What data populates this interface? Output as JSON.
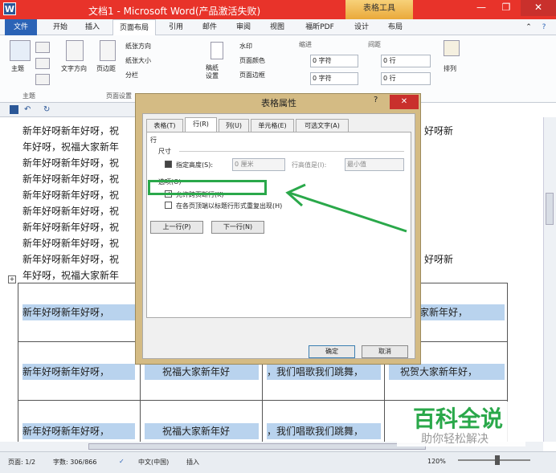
{
  "window": {
    "title": "文档1 - Microsoft Word(产品激活失败)",
    "context_tab": "表格工具",
    "app_icon": "W"
  },
  "tabs": [
    "文件",
    "开始",
    "插入",
    "页面布局",
    "引用",
    "邮件",
    "审阅",
    "视图",
    "福昕PDF",
    "设计",
    "布局"
  ],
  "ribbon": {
    "theme": {
      "label": "主题",
      "group": "主题"
    },
    "page_setup": {
      "direction": "文字方向",
      "margins": "页边距",
      "orientation": "纸张方向",
      "size": "纸张大小",
      "columns": "分栏",
      "group": "页面设置"
    },
    "draft": "稿纸\n设置",
    "bg": {
      "watermark": "水印",
      "page_color": "页面颜色",
      "page_border": "页面边框"
    },
    "indent": {
      "label": "缩进",
      "left": "0 字符",
      "right": "0 字符"
    },
    "spacing": {
      "label": "间距",
      "before": "0 行",
      "after": "0 行"
    },
    "arrange": "排列"
  },
  "document": {
    "lines": [
      "新年好呀新年好呀，祝",
      "年好呀，祝福大家新年",
      "新年好呀新年好呀，祝",
      "新年好呀新年好呀，祝",
      "新年好呀新年好呀，祝",
      "新年好呀新年好呀，祝",
      "新年好呀新年好呀，祝",
      "新年好呀新年好呀，祝",
      "新年好呀新年好呀，祝",
      "年好呀，祝福大家新年"
    ],
    "right_lines": [
      "好呀新",
      "好呀新"
    ],
    "table_rows": [
      [
        "新年好呀新年好呀，",
        "",
        "",
        "贺大家新年好，"
      ],
      [
        "新年好呀新年好呀，",
        "祝福大家新年好",
        "，我们唱歌我们跳舞，",
        "祝贺大家新年好，"
      ],
      [
        "新年好呀新年好呀，",
        "祝福大家新年好",
        "，我们唱歌我们跳舞，",
        "祝贺大家新年好，"
      ]
    ]
  },
  "dialog": {
    "title": "表格属性",
    "help": "?",
    "close": "✕",
    "tabs": [
      "表格(T)",
      "行(R)",
      "列(U)",
      "单元格(E)",
      "可选文字(A)"
    ],
    "section_row": "行",
    "section_size": "尺寸",
    "specify_height": "指定高度(S):",
    "height_value": "0 厘米",
    "row_height_is": "行高值是(I):",
    "row_height_mode": "最小值",
    "section_options": "选项(O)",
    "allow_break": "允许跨页断行(K)",
    "allow_break_checked": true,
    "repeat_header": "在各页顶端以标题行形式重复出现(H)",
    "repeat_header_checked": false,
    "prev_row": "上一行(P)",
    "next_row": "下一行(N)",
    "ok": "确定",
    "cancel": "取消"
  },
  "status": {
    "page": "页面: 1/2",
    "words": "字数: 306/866",
    "lang": "中文(中国)",
    "mode": "插入",
    "zoom": "120%"
  },
  "watermark": {
    "main": "百科全说",
    "sub": "助你轻松解决"
  },
  "colors": {
    "title_red": "#e8332a",
    "annotation_green": "#2aa84a"
  }
}
